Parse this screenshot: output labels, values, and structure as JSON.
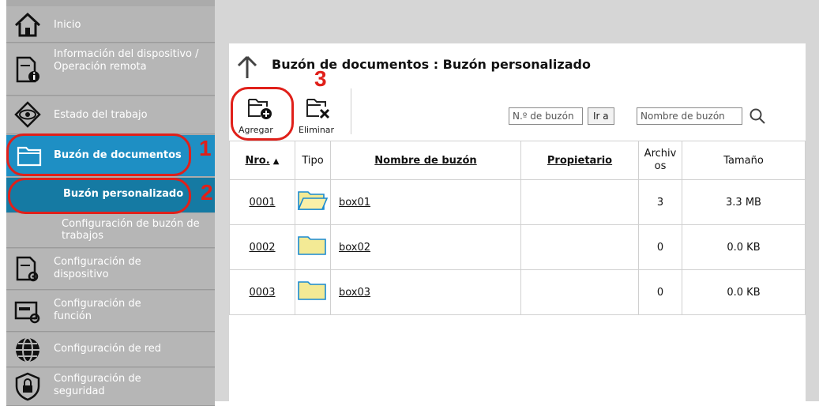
{
  "sidebar": {
    "items": [
      {
        "label": "Inicio",
        "icon": "home-icon"
      },
      {
        "label": "Información del dispositivo / Operación remota",
        "icon": "device-info-icon"
      },
      {
        "label": "Estado del trabajo",
        "icon": "eye-icon"
      },
      {
        "label": "Buzón de documentos",
        "icon": "folder-icon"
      },
      {
        "label": "Buzón personalizado"
      },
      {
        "label": "Configuración de buzón de trabajos"
      },
      {
        "label": "Configuración de dispositivo",
        "icon": "device-settings-icon"
      },
      {
        "label": "Configuración de función",
        "icon": "function-settings-icon"
      },
      {
        "label": "Configuración de red",
        "icon": "globe-icon"
      },
      {
        "label": "Configuración de seguridad",
        "icon": "shield-lock-icon"
      }
    ]
  },
  "header": {
    "title": "Buzón de documentos : Buzón personalizado"
  },
  "toolbar": {
    "add_label": "Agregar",
    "delete_label": "Eliminar",
    "box_number_placeholder": "N.º de buzón",
    "go_label": "Ir a",
    "box_name_placeholder": "Nombre de buzón"
  },
  "table": {
    "headers": [
      "Nro.",
      "Tipo",
      "Nombre de buzón",
      "Propietario",
      "Archivos",
      "Tamaño"
    ],
    "rows": [
      {
        "number": "0001",
        "name": "box01",
        "owner": "",
        "files": "3",
        "size": "3.3 MB",
        "open": true
      },
      {
        "number": "0002",
        "name": "box02",
        "owner": "",
        "files": "0",
        "size": "0.0 KB",
        "open": false
      },
      {
        "number": "0003",
        "name": "box03",
        "owner": "",
        "files": "0",
        "size": "0.0 KB",
        "open": false
      }
    ]
  },
  "annotations": [
    "1",
    "2",
    "3"
  ],
  "colors": {
    "active_blue": "#1e8fc4",
    "sub_blue": "#157aa3",
    "annotation_red": "#e0201a"
  }
}
